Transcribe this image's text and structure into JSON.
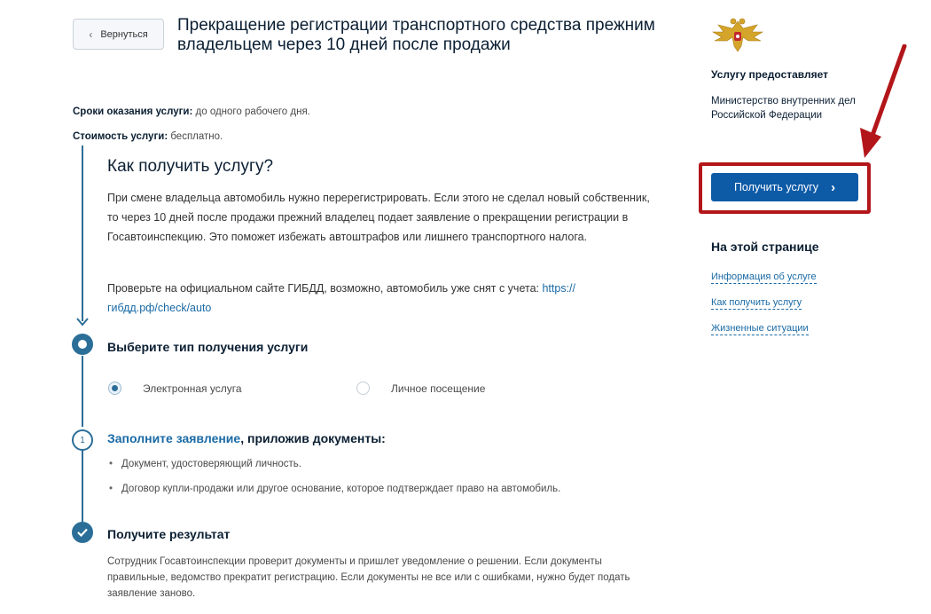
{
  "header": {
    "back_label": "Вернуться",
    "title": "Прекращение регистрации транспортного средства прежним владельцем через 10 дней после продажи"
  },
  "meta": {
    "terms_label": "Сроки оказания услуги:",
    "terms_value": " до одного рабочего дня.",
    "cost_label": "Стоимость услуги:",
    "cost_value": " бесплатно."
  },
  "how": {
    "title": "Как получить услугу?",
    "paragraph1": "При смене владельца автомобиль нужно перерегистрировать. Если этого не сделал новый собственник, то через 10 дней после продажи прежний владелец подает заявление о прекращении регистрации в Госавтоинспекцию. Это поможет избежать автоштрафов или лишнего транспортного налога.",
    "paragraph2_text": "Проверьте на официальном сайте ГИБДД, возможно, автомобиль уже снят с учета: ",
    "paragraph2_link": "https:// гибдд.рф/check/auto"
  },
  "steps": {
    "step1_title": "Выберите тип получения услуги",
    "option_electronic": "Электронная услуга",
    "option_personal": "Личное посещение",
    "step2_number": "1",
    "step2_link": "Заполните заявление",
    "step2_rest": ", приложив документы:",
    "documents": [
      "Документ, удостоверяющий личность.",
      "Договор купли-продажи или другое основание, которое подтверждает право на автомобиль."
    ],
    "step3_title": "Получите результат",
    "step3_text": "Сотрудник Госавтоинспекции проверит документы и пришлет уведомление о решении. Если документы правильные, ведомство прекратит регистрацию. Если документы не все или с ошибками, нужно будет подать заявление заново."
  },
  "sidebar": {
    "emblem_icon": "russian-eagle-emblem",
    "provider_label": "Услугу предоставляет",
    "provider_name": "Министерство внутренних дел Российской Федерации",
    "get_service_label": "Получить услугу",
    "onpage_title": "На этой странице",
    "links": [
      "Информация об услуге",
      "Как получить услугу",
      "Жизненные ситуации"
    ]
  },
  "colors": {
    "accent": "#2b6e98",
    "button": "#0d5aa7",
    "highlight": "#b3161a",
    "link": "#1a6aa5"
  }
}
